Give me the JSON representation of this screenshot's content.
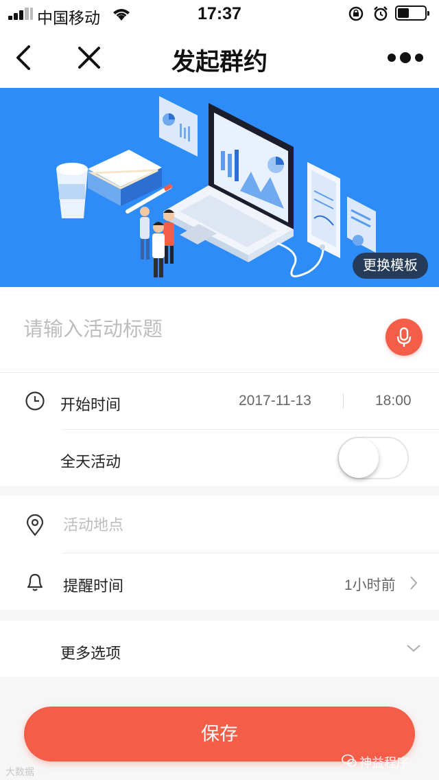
{
  "status_bar": {
    "carrier": "中国移动",
    "time": "17:37"
  },
  "nav": {
    "title": "发起群约",
    "back_icon": "chevron-left-icon",
    "close_icon": "close-icon",
    "more_icon": "more-dots-icon"
  },
  "banner": {
    "template_button": "更换模板",
    "background_color": "#2d8cf7"
  },
  "form": {
    "title_placeholder": "请输入活动标题",
    "start_time_label": "开始时间",
    "start_date": "2017-11-13",
    "start_time": "18:00",
    "all_day_label": "全天活动",
    "all_day_enabled": false,
    "location_placeholder": "活动地点",
    "reminder_label": "提醒时间",
    "reminder_value": "1小时前",
    "more_options_label": "更多选项"
  },
  "save_button": "保存",
  "watermarks": {
    "left": "大数据",
    "right": "神益程序"
  },
  "colors": {
    "accent": "#f45d47",
    "banner": "#2d8cf7",
    "template_button": "#243b5a"
  }
}
